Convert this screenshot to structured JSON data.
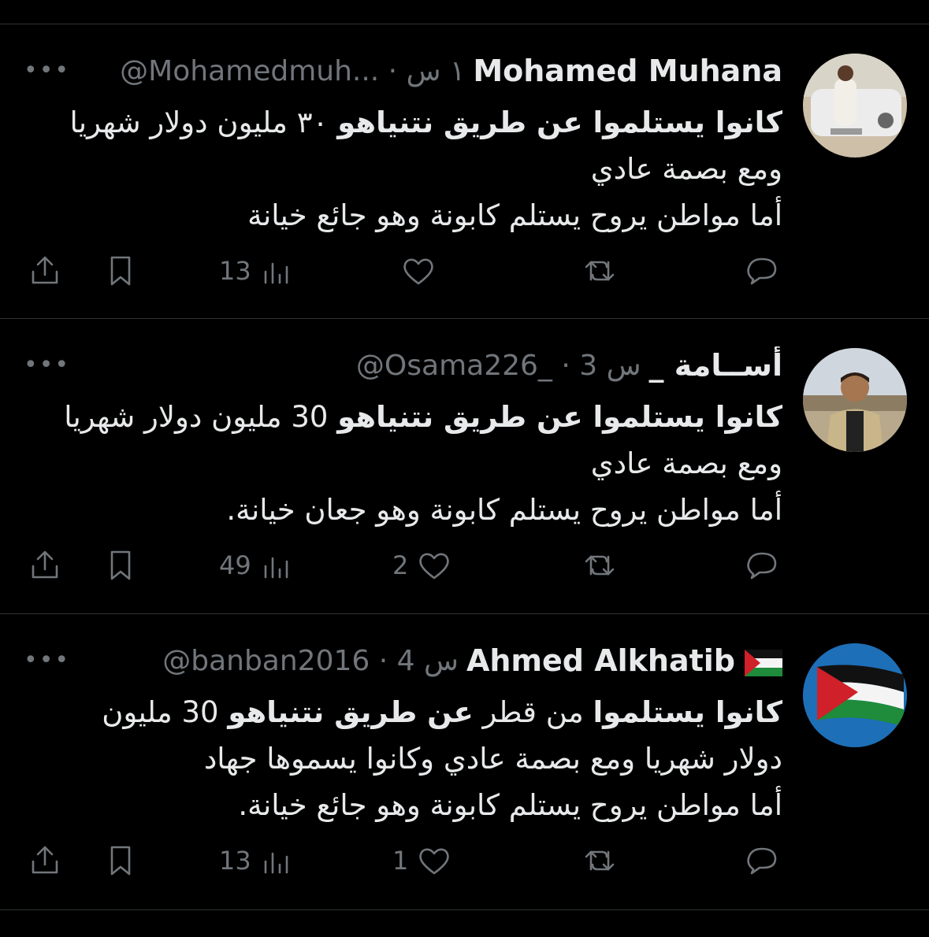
{
  "tweets": [
    {
      "name": "Mohamed Muhana",
      "meta": "@Mohamedmuh... · ١ س",
      "body": {
        "l1_bold": "كانوا يستلموا عن طريق نتنياهو",
        "l1_rest": " ٣٠ مليون دولار شهريا",
        "l2": "ومع بصمة عادي",
        "l3": "أما مواطن يروح يستلم كابونة وهو جائع خيانة"
      },
      "views": "13",
      "likes": "",
      "has_flag": false
    },
    {
      "name": "أســامة _",
      "meta": "@Osama226_ · 3 س",
      "body": {
        "l1_bold": "كانوا يستلموا عن طريق نتنياهو",
        "l1_rest": " 30 مليون دولار شهريا",
        "l2": "ومع بصمة عادي",
        "l3": "أما مواطن يروح يستلم كابونة وهو جعان خيانة."
      },
      "views": "49",
      "likes": "2",
      "has_flag": false
    },
    {
      "name": "Ahmed Alkhatib",
      "meta": "@banban2016 · 4 س",
      "body": {
        "l1_a": "كانوا يستلموا",
        "l1_b": " من قطر ",
        "l1_c": "عن طريق نتنياهو",
        "l1_d": " 30 مليون",
        "l2": "دولار شهريا ومع بصمة عادي وكانوا يسموها جهاد",
        "l3": "أما مواطن يروح يستلم كابونة وهو جائع خيانة."
      },
      "views": "13",
      "likes": "1",
      "has_flag": true
    }
  ],
  "more_label": "•••",
  "icons": [
    "share-icon",
    "bookmark-icon",
    "views-icon",
    "like-icon",
    "retweet-icon",
    "reply-icon",
    "palestine-flag-icon"
  ],
  "colors": {
    "background": "#000000",
    "text": "#e7e9ea",
    "muted": "#71767b",
    "divider": "#2f3336"
  }
}
